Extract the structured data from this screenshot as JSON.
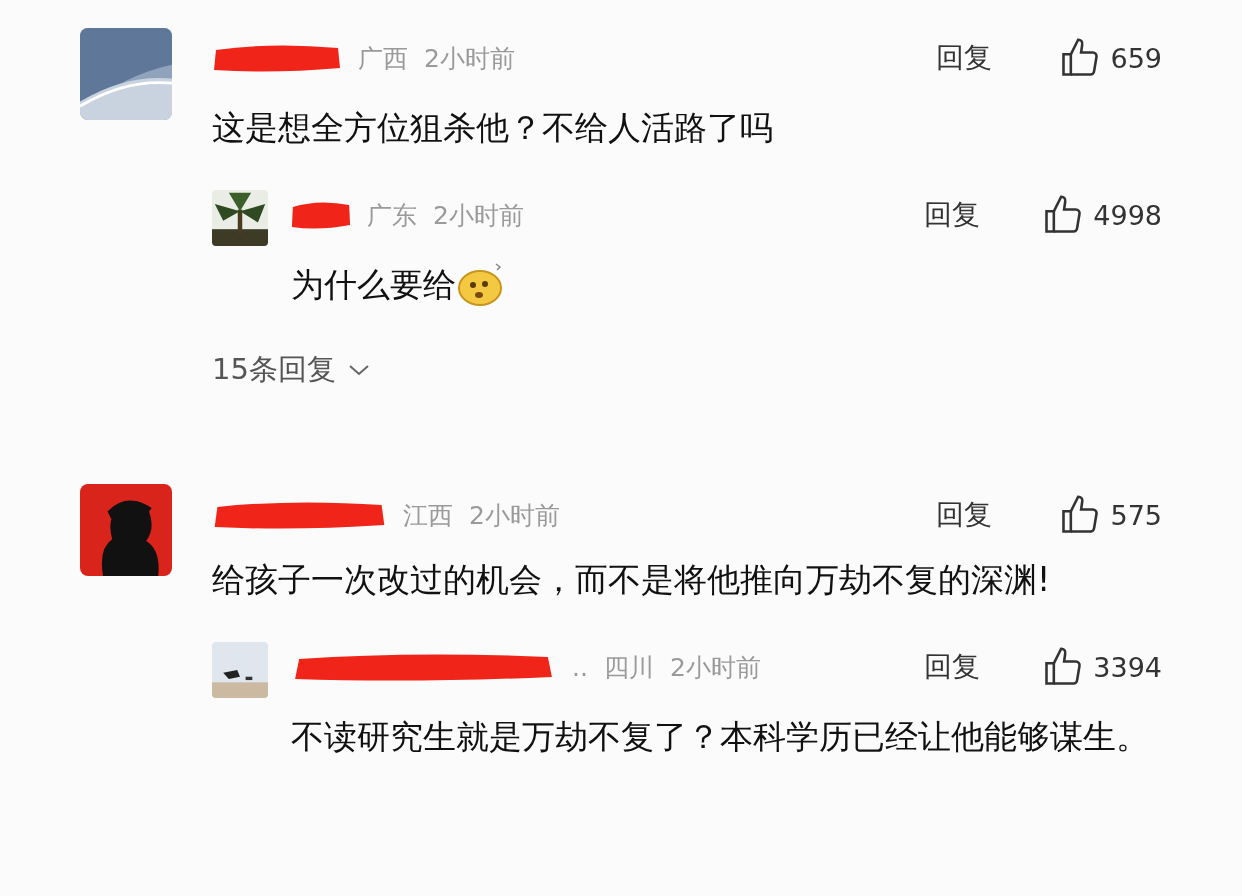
{
  "threads": [
    {
      "comment": {
        "redacted": true,
        "location": "广西",
        "time": "2小时前",
        "reply_label": "回复",
        "likes": "659",
        "text": "这是想全方位狙杀他？不给人活路了吗"
      },
      "replies": [
        {
          "redacted": true,
          "location": "广东",
          "time": "2小时前",
          "reply_label": "回复",
          "likes": "4998",
          "text": "为什么要给",
          "emoji": true
        }
      ],
      "more_replies": "15条回复"
    },
    {
      "comment": {
        "redacted": true,
        "location": "江西",
        "time": "2小时前",
        "reply_label": "回复",
        "likes": "575",
        "text": "给孩子一次改过的机会，而不是将他推向万劫不复的深渊!"
      },
      "replies": [
        {
          "redacted": true,
          "name_suffix": "..",
          "location": "四川",
          "time": "2小时前",
          "reply_label": "回复",
          "likes": "3394",
          "text": "不读研究生就是万劫不复了？本科学历已经让他能够谋生。"
        }
      ]
    }
  ]
}
